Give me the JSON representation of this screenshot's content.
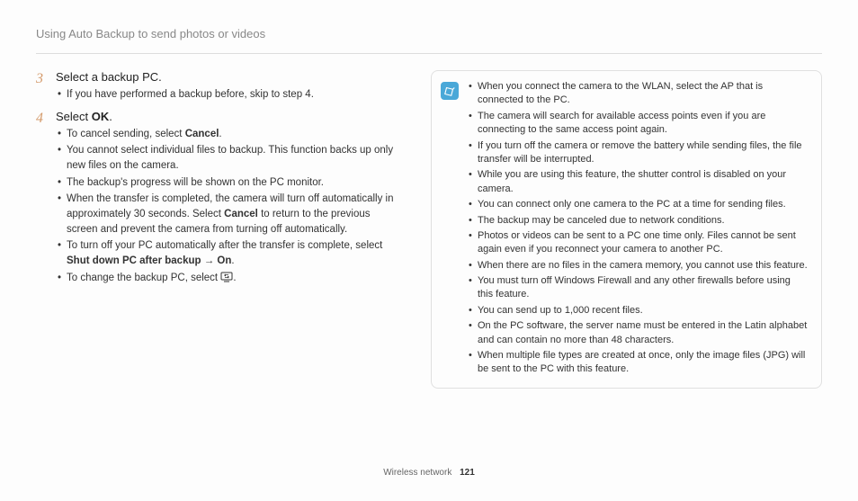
{
  "header": {
    "title": "Using Auto Backup to send photos or videos"
  },
  "steps": [
    {
      "num": "3",
      "title_pre": "Select a backup PC.",
      "bullets": [
        {
          "text": "If you have performed a backup before, skip to step 4."
        }
      ]
    },
    {
      "num": "4",
      "title_pre": "Select ",
      "title_bold": "OK",
      "title_post": ".",
      "bullets": [
        {
          "pre": "To cancel sending, select ",
          "bold1": "Cancel",
          "post1": "."
        },
        {
          "text": "You cannot select individual files to backup. This function backs up only new files on the camera."
        },
        {
          "text": "The backup's progress will be shown on the PC monitor."
        },
        {
          "pre": "When the transfer is completed, the camera will turn off automatically in approximately 30 seconds. Select ",
          "bold1": "Cancel",
          "post1": " to return to the previous screen and prevent the camera from turning off automatically."
        },
        {
          "pre": "To turn off your PC automatically after the transfer is complete, select ",
          "bold1": "Shut down PC after backup",
          "arrow": " → ",
          "bold2": "On",
          "post2": "."
        },
        {
          "pre": "To change the backup PC, select ",
          "icon": "pc-change-icon",
          "post1": "."
        }
      ]
    }
  ],
  "notes": [
    "When you connect the camera to the WLAN, select the AP that is connected to the PC.",
    "The camera will search for available access points even if you are connecting to the same access point again.",
    "If you turn off the camera or remove the battery while sending files, the file transfer will be interrupted.",
    "While you are using this feature, the shutter control is disabled on your camera.",
    "You can connect only one camera to the PC at a time for sending files.",
    "The backup may be canceled due to network conditions.",
    "Photos or videos can be sent to a PC one time only. Files cannot be sent again even if you reconnect your camera to another PC.",
    "When there are no files in the camera memory, you cannot use this feature.",
    "You must turn off Windows Firewall and any other firewalls before using this feature.",
    "You can send up to 1,000 recent files.",
    "On the PC software, the server name must be entered in the Latin alphabet and can contain no more than 48 characters.",
    "When multiple file types are created at once, only the image files (JPG) will be sent to the PC with this feature."
  ],
  "footer": {
    "section": "Wireless network",
    "page": "121"
  }
}
